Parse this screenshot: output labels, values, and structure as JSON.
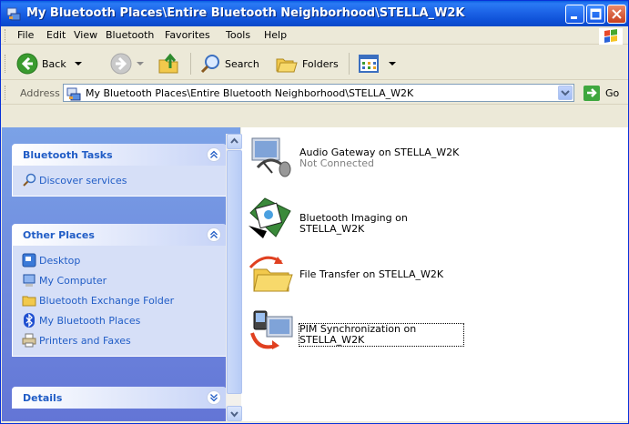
{
  "window": {
    "title": "My Bluetooth Places\\Entire Bluetooth Neighborhood\\STELLA_W2K"
  },
  "menu": {
    "items": [
      "File",
      "Edit",
      "View",
      "Bluetooth",
      "Favorites",
      "Tools",
      "Help"
    ]
  },
  "toolbar": {
    "back_label": "Back",
    "search_label": "Search",
    "folders_label": "Folders"
  },
  "address": {
    "label": "Address",
    "value": "My Bluetooth Places\\Entire Bluetooth Neighborhood\\STELLA_W2K",
    "go_label": "Go"
  },
  "tasks_panel": {
    "title": "Bluetooth Tasks",
    "items": [
      "Discover services"
    ]
  },
  "other_places": {
    "title": "Other Places",
    "items": [
      "Desktop",
      "My Computer",
      "Bluetooth Exchange Folder",
      "My Bluetooth Places",
      "Printers and Faxes"
    ]
  },
  "details_panel": {
    "title": "Details"
  },
  "services": [
    {
      "name": "Audio Gateway on STELLA_W2K",
      "status": "Not Connected",
      "icon": "headset-icon"
    },
    {
      "name": "Bluetooth Imaging on",
      "name2": "STELLA_W2K",
      "icon": "imaging-icon"
    },
    {
      "name": "File Transfer on STELLA_W2K",
      "icon": "file-transfer-icon"
    },
    {
      "name": "PIM Synchronization on",
      "name2": "STELLA_W2K",
      "icon": "pim-sync-icon"
    }
  ]
}
